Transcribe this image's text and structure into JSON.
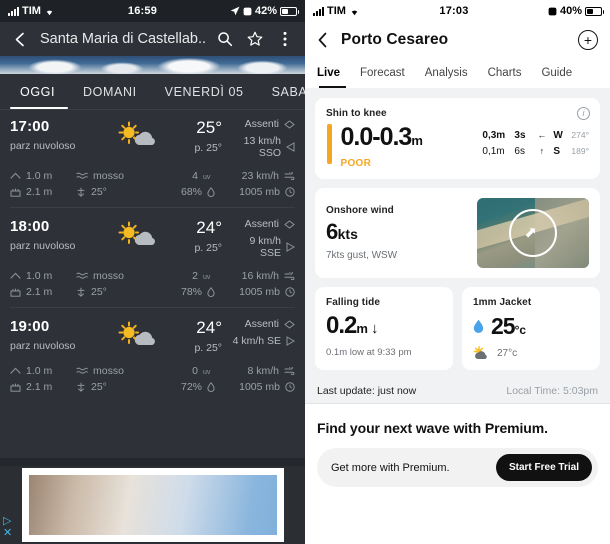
{
  "left_phone": {
    "status_bar": {
      "carrier": "TIM",
      "time": "16:59",
      "battery": "42%",
      "icons": [
        "signal-bars-icon",
        "wifi-icon",
        "location-arrow-icon",
        "alarm-icon",
        "battery-icon"
      ]
    },
    "app_bar": {
      "back": "‹",
      "title": "Santa Maria di Castellab...",
      "search_icon": "search-icon",
      "star_icon": "star-icon",
      "menu_icon": "overflow-menu-icon"
    },
    "day_tabs": [
      {
        "label": "OGGI",
        "active": true
      },
      {
        "label": "DOMANI",
        "active": false
      },
      {
        "label": "VENERDÌ 05",
        "active": false
      },
      {
        "label": "SABATO",
        "active": false
      }
    ],
    "hours": [
      {
        "time": "17:00",
        "desc": "parz nuvoloso",
        "icon": "sun-behind-cloud-icon",
        "temp": "25°",
        "feels": "p. 25°",
        "precip_label": "Assenti",
        "wind": "13 km/h SSO",
        "wave_height": "1.0 m",
        "sea_state": "mosso",
        "swell": "2.1 m",
        "swell_dir": "25°",
        "uv": "4",
        "humidity": "68%",
        "gust": "23 km/h",
        "pressure": "1005 mb"
      },
      {
        "time": "18:00",
        "desc": "parz nuvoloso",
        "icon": "sun-behind-cloud-icon",
        "temp": "24°",
        "feels": "p. 25°",
        "precip_label": "Assenti",
        "wind": "9 km/h SSE",
        "wave_height": "1.0 m",
        "sea_state": "mosso",
        "swell": "2.1 m",
        "swell_dir": "25°",
        "uv": "2",
        "humidity": "78%",
        "gust": "16 km/h",
        "pressure": "1005 mb"
      },
      {
        "time": "19:00",
        "desc": "parz nuvoloso",
        "icon": "sun-behind-cloud-icon",
        "temp": "24°",
        "feels": "p. 25°",
        "precip_label": "Assenti",
        "wind": "4 km/h SE",
        "wave_height": "1.0 m",
        "sea_state": "mosso",
        "swell": "2.1 m",
        "swell_dir": "25°",
        "uv": "0",
        "humidity": "72%",
        "gust": "8 km/h",
        "pressure": "1005 mb"
      }
    ],
    "ad": {
      "play_icon": "ad-play-icon",
      "close_icon": "ad-close-icon"
    }
  },
  "right_phone": {
    "status_bar": {
      "carrier": "TIM",
      "time": "17:03",
      "battery": "40%",
      "icons": [
        "signal-bars-icon",
        "wifi-icon",
        "alarm-icon",
        "battery-icon"
      ]
    },
    "app_bar": {
      "back": "‹",
      "title": "Porto Cesareo",
      "add_label": "+"
    },
    "tabs": [
      {
        "label": "Live",
        "active": true
      },
      {
        "label": "Forecast",
        "active": false
      },
      {
        "label": "Analysis",
        "active": false
      },
      {
        "label": "Charts",
        "active": false
      },
      {
        "label": "Guide",
        "active": false
      }
    ],
    "surf_card": {
      "label": "Shin to knee",
      "height": "0.0-0.3",
      "unit": "m",
      "rating": "POOR",
      "rating_color": "#f5a623",
      "info_icon": "info-icon",
      "swells": [
        {
          "height": "0,3m",
          "period": "3s",
          "arrow": "←",
          "dir": "W",
          "deg": "274°"
        },
        {
          "height": "0,1m",
          "period": "6s",
          "arrow": "↑",
          "dir": "S",
          "deg": "189°"
        }
      ]
    },
    "wind_card": {
      "label": "Onshore wind",
      "value": "6",
      "unit": "kts",
      "sub": "7kts gust, WSW",
      "map_icon": "wind-direction-arrow-icon"
    },
    "tide_card": {
      "label": "Falling tide",
      "value": "0.2",
      "unit": "m",
      "arrow": "↓",
      "sub": "0.1m low at 9:33 pm"
    },
    "wetsuit_card": {
      "label": "1mm Jacket",
      "water_icon": "water-drop-icon",
      "water_temp": "25",
      "water_unit": "°c",
      "weather_icon": "sun-behind-cloud-icon",
      "air_temp": "27°c"
    },
    "footer": {
      "last_update": "Last update: just now",
      "local_time": "Local Time: 5:03pm"
    },
    "premium": {
      "heading": "Find your next wave with Premium.",
      "sub": "Get more with Premium.",
      "cta": "Start Free Trial"
    }
  }
}
